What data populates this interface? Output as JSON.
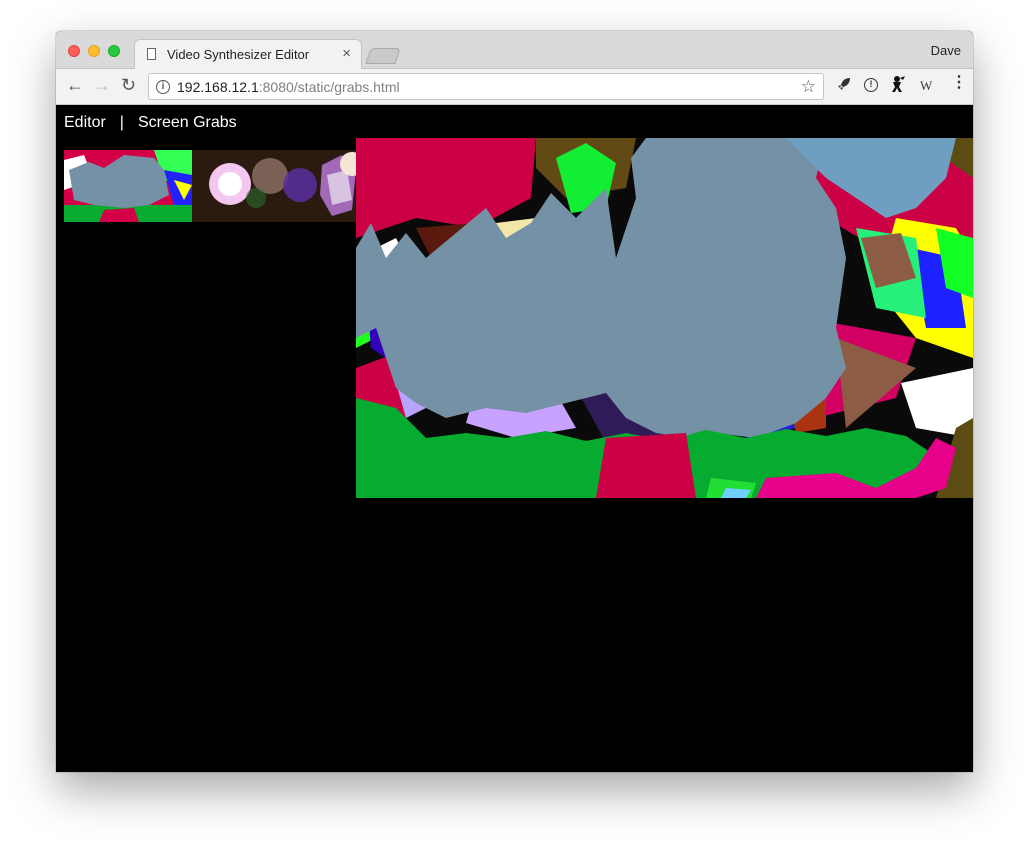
{
  "browser": {
    "tab_title": "Video Synthesizer Editor",
    "tab_close": "×",
    "profile_name": "Dave",
    "url_host": "192.168.12.1",
    "url_path": ":8080/static/grabs.html",
    "icons": [
      "back-icon",
      "forward-icon",
      "reload-icon",
      "info-icon",
      "star-icon",
      "rocket-extension-icon",
      "info-extension-icon",
      "ninja-extension-icon",
      "wikipedia-extension-icon",
      "menu-icon"
    ]
  },
  "nav": {
    "editor": "Editor",
    "separator": "|",
    "screen_grabs": "Screen Grabs"
  },
  "colors": {
    "background": "#000000",
    "nav_text": "#ffffff",
    "slate": "#7591a6",
    "green": "#06ab2f",
    "crimson": "#cc0044"
  }
}
